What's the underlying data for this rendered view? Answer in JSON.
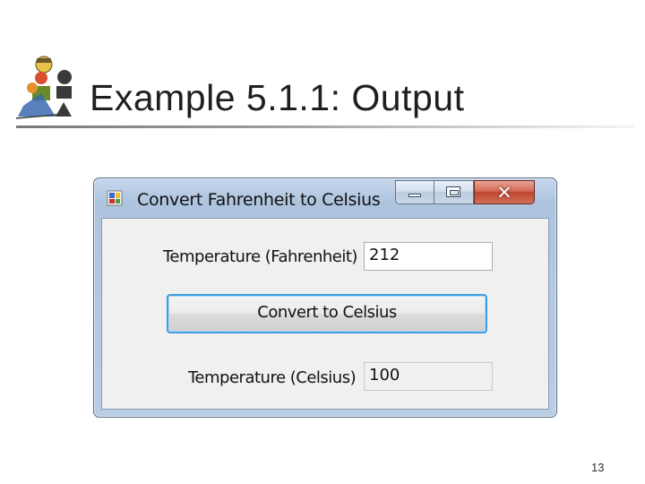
{
  "slide": {
    "title": "Example 5.1.1: Output",
    "page_number": "13"
  },
  "window": {
    "title": "Convert Fahrenheit to Celsius",
    "controls": {
      "minimize": "minimize",
      "maximize": "maximize",
      "close": "✕"
    }
  },
  "form": {
    "fahrenheit_label": "Temperature (Fahrenheit)",
    "fahrenheit_value": "212",
    "convert_button": "Convert to Celsius",
    "celsius_label": "Temperature (Celsius)",
    "celsius_value": "100"
  },
  "colors": {
    "focus_border": "#3c9ee0",
    "close_button": "#c0442c",
    "title_bar": "#b9cde4"
  }
}
